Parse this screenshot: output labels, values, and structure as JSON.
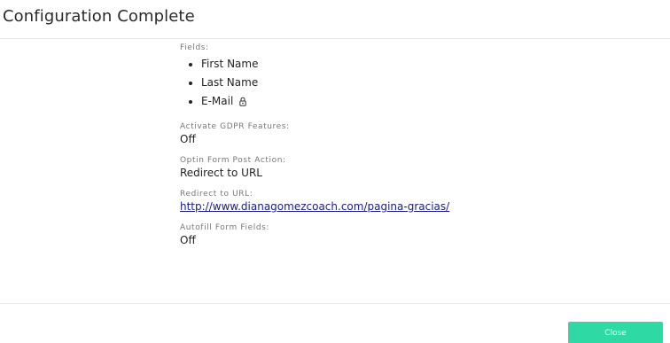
{
  "header": {
    "title": "Configuration Complete"
  },
  "body": {
    "fields": {
      "label": "Fields:",
      "items": [
        {
          "label": "First Name",
          "locked": false
        },
        {
          "label": "Last Name",
          "locked": false
        },
        {
          "label": "E-Mail",
          "locked": true,
          "icon": "lock-icon"
        }
      ]
    },
    "gdpr": {
      "label": "Activate GDPR Features:",
      "value": "Off"
    },
    "post_action": {
      "label": "Optin Form Post Action:",
      "value": "Redirect to URL"
    },
    "redirect_url": {
      "label": "Redirect to URL:",
      "value": "http://www.dianagomezcoach.com/pagina-gracias/"
    },
    "autofill": {
      "label": "Autofill Form Fields:",
      "value": "Off"
    }
  },
  "footer": {
    "close_label": "Close"
  },
  "colors": {
    "accent": "#2ed9a4",
    "link": "#1a1a8c",
    "label": "#777777",
    "divider": "#e8e8e8"
  }
}
